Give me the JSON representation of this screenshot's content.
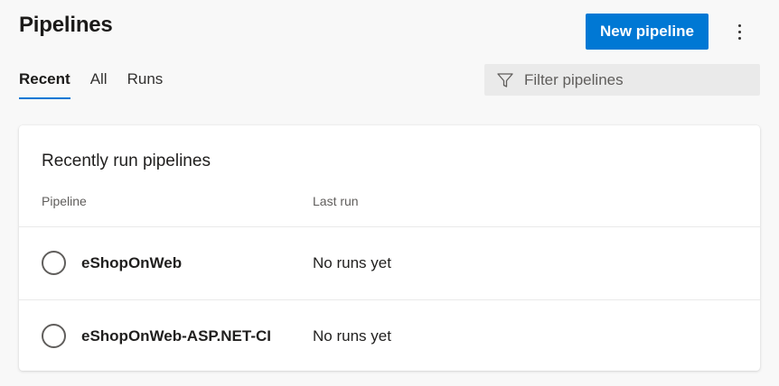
{
  "header": {
    "title": "Pipelines",
    "new_button_label": "New pipeline",
    "more_icon": "more-vertical-icon"
  },
  "tabs": [
    {
      "label": "Recent",
      "selected": true
    },
    {
      "label": "All",
      "selected": false
    },
    {
      "label": "Runs",
      "selected": false
    }
  ],
  "filter": {
    "icon": "filter-icon",
    "placeholder": "Filter pipelines",
    "value": ""
  },
  "card": {
    "title": "Recently run pipelines",
    "columns": [
      "Pipeline",
      "Last run"
    ],
    "rows": [
      {
        "name": "eShopOnWeb",
        "last_run": "No runs yet",
        "status_icon": "status-not-run-icon"
      },
      {
        "name": "eShopOnWeb-ASP.NET-CI",
        "last_run": "No runs yet",
        "status_icon": "status-not-run-icon"
      }
    ]
  },
  "colors": {
    "accent": "#0078d4",
    "background": "#f8f8f8",
    "card": "#ffffff",
    "filter_bg": "#eaeaea"
  }
}
